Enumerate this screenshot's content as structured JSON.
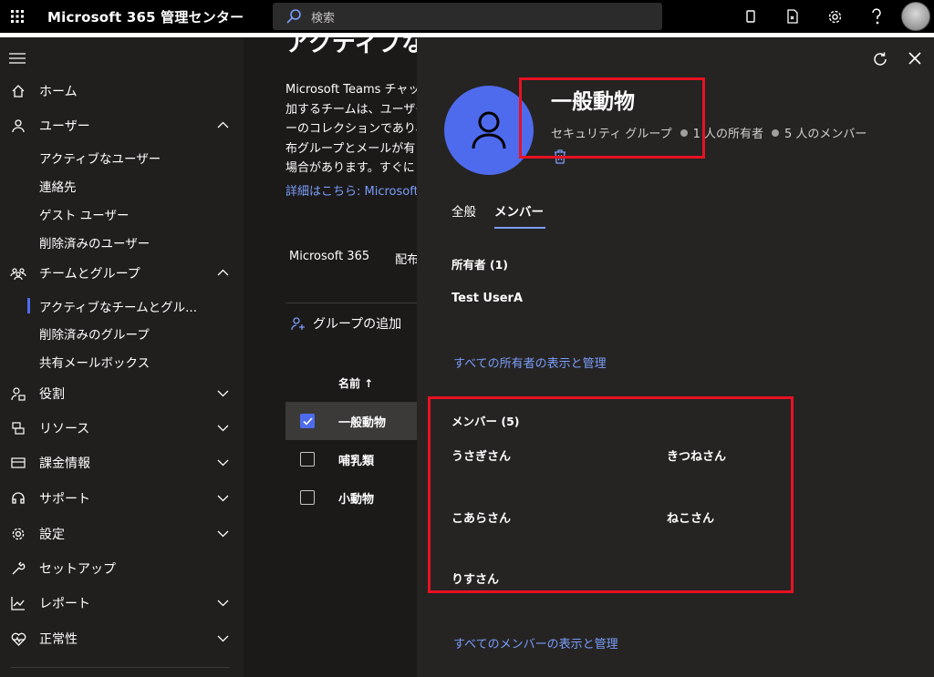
{
  "topbar": {
    "app_title": "Microsoft 365 管理センター",
    "search_placeholder": "検索"
  },
  "sidebar": {
    "items": [
      {
        "label": "ホーム"
      },
      {
        "label": "ユーザー"
      },
      {
        "label": "アクティブなユーザー"
      },
      {
        "label": "連絡先"
      },
      {
        "label": "ゲスト ユーザー"
      },
      {
        "label": "削除済みのユーザー"
      },
      {
        "label": "チームとグループ"
      },
      {
        "label": "アクティブなチームとグル..."
      },
      {
        "label": "削除済みのグループ"
      },
      {
        "label": "共有メールボックス"
      },
      {
        "label": "役割"
      },
      {
        "label": "リソース"
      },
      {
        "label": "課金情報"
      },
      {
        "label": "サポート"
      },
      {
        "label": "設定"
      },
      {
        "label": "セットアップ"
      },
      {
        "label": "レポート"
      },
      {
        "label": "正常性"
      }
    ]
  },
  "main": {
    "heading_fragment": "アクティブな",
    "desc_lines": [
      "Microsoft Teams チャット",
      "加するチームは、ユーザー",
      "ーのコレクションであり、",
      "布グループとメールが有",
      "場合があります。すぐに"
    ],
    "more_link": "詳細はこちら: Microsoft",
    "tabs": [
      "Microsoft 365",
      "配布リスト"
    ],
    "add_group": "グループの追加",
    "col_name": "名前 ↑",
    "rows": [
      {
        "name": "一般動物"
      },
      {
        "name": "哺乳類"
      },
      {
        "name": "小動物"
      }
    ]
  },
  "panel": {
    "title": "一般動物",
    "group_type": "セキュリティ グループ",
    "owners_count": "1 人の所有者",
    "members_count": "5 人のメンバー",
    "tabs": [
      "全般",
      "メンバー"
    ],
    "owners_title": "所有者 (1)",
    "owners": [
      "Test UserA"
    ],
    "owners_link": "すべての所有者の表示と管理",
    "members_title": "メンバー (5)",
    "members": [
      "うさぎさん",
      "きつねさん",
      "こあらさん",
      "ねこさん",
      "りすさん"
    ],
    "members_link": "すべてのメンバーの表示と管理"
  },
  "colors": {
    "accent": "#4f6bed",
    "link": "#7b9dfb",
    "highlight": "#e81123"
  }
}
